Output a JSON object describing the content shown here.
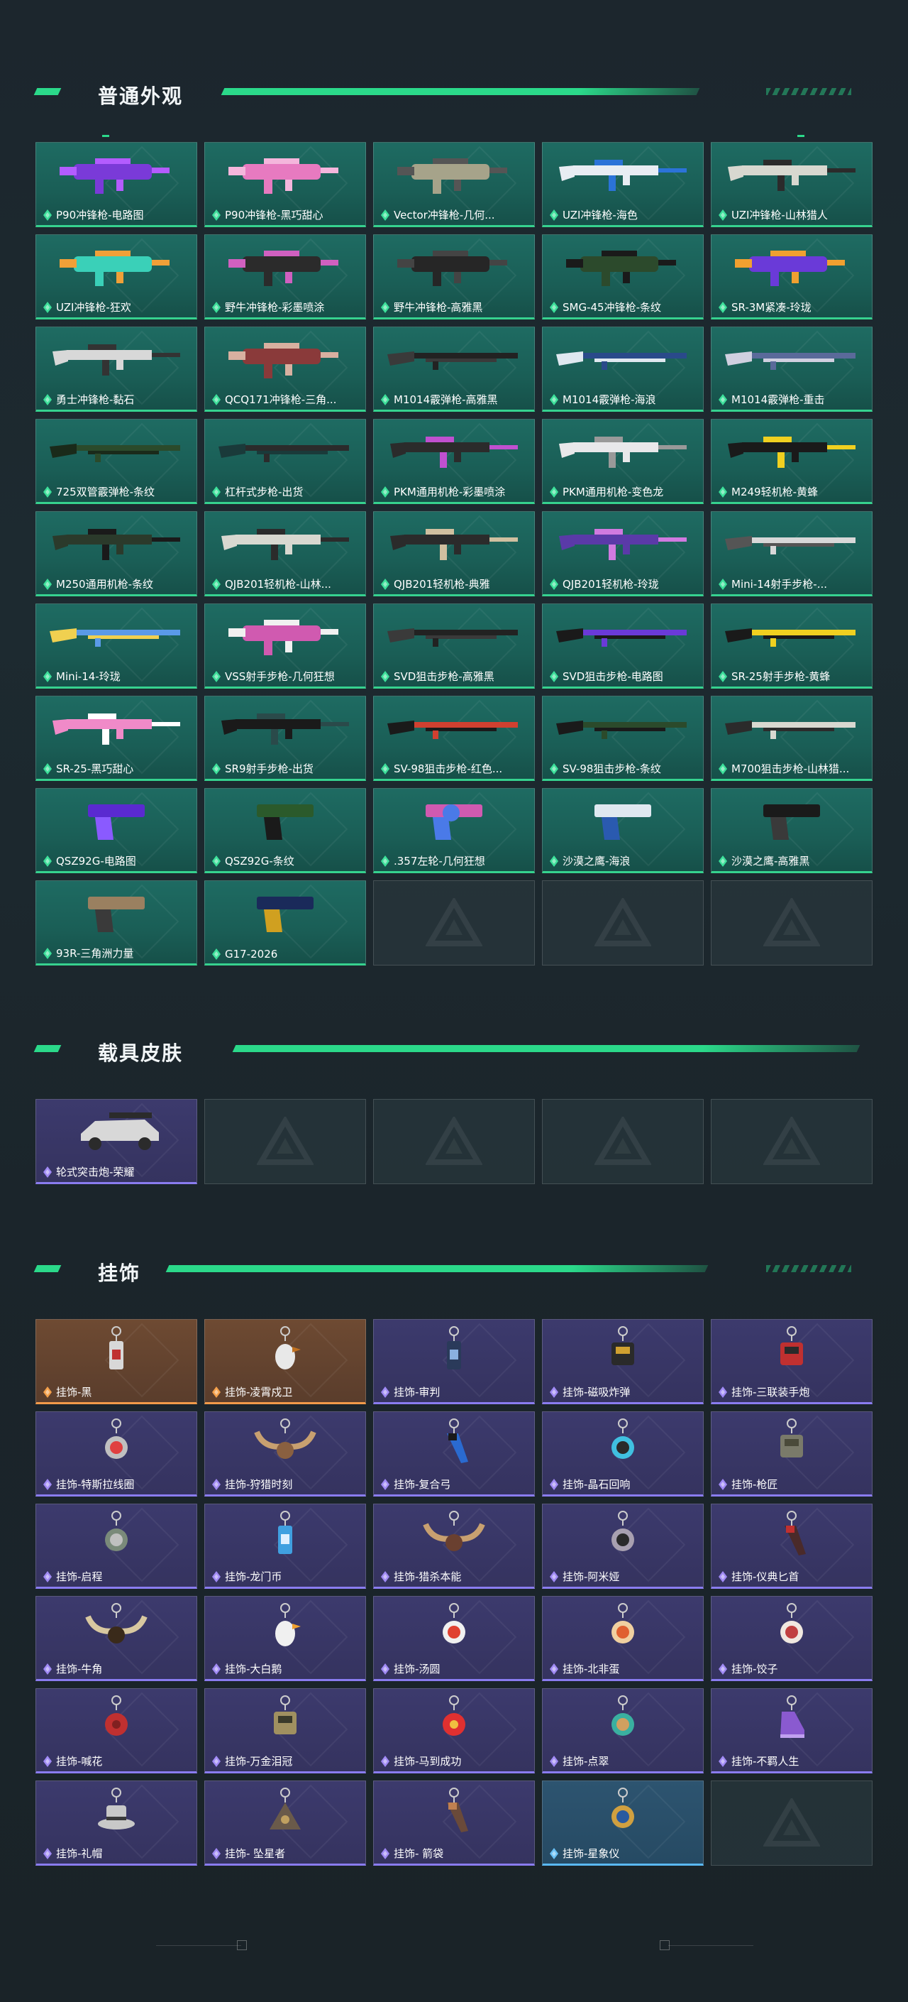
{
  "sections": {
    "weapons": {
      "title": "普通外观",
      "items": [
        {
          "label": "P90冲锋枪-电路图",
          "kind": "smg",
          "c1": "#7a3ad8",
          "c2": "#b35cff"
        },
        {
          "label": "P90冲锋枪-黑巧甜心",
          "kind": "smg",
          "c1": "#e77ac0",
          "c2": "#f4b6dc"
        },
        {
          "label": "Vector冲锋枪-几何...",
          "kind": "smg",
          "c1": "#a6a38a",
          "c2": "#555"
        },
        {
          "label": "UZI冲锋枪-海色",
          "kind": "rifle",
          "c1": "#e8edf3",
          "c2": "#2b73d8"
        },
        {
          "label": "UZI冲锋枪-山林猎人",
          "kind": "rifle",
          "c1": "#d8d8d0",
          "c2": "#2b2b2b"
        },
        {
          "label": "UZI冲锋枪-狂欢",
          "kind": "smg",
          "c1": "#3ad0b8",
          "c2": "#f0a038"
        },
        {
          "label": "野牛冲锋枪-彩墨喷涂",
          "kind": "smg",
          "c1": "#2b2b2b",
          "c2": "#d060c0"
        },
        {
          "label": "野牛冲锋枪-高雅黑",
          "kind": "smg",
          "c1": "#262626",
          "c2": "#444"
        },
        {
          "label": "SMG-45冲锋枪-条纹",
          "kind": "smg",
          "c1": "#2c4a2c",
          "c2": "#1a1a1a"
        },
        {
          "label": "SR-3M紧凑-玲珑",
          "kind": "smg",
          "c1": "#6a3ad8",
          "c2": "#f0a030"
        },
        {
          "label": "勇士冲锋枪-黏石",
          "kind": "rifle",
          "c1": "#d8d8d8",
          "c2": "#333"
        },
        {
          "label": "QCQ171冲锋枪-三角...",
          "kind": "smg",
          "c1": "#8a3a3a",
          "c2": "#d8b0a0"
        },
        {
          "label": "M1014霰弹枪-高雅黑",
          "kind": "shotgun",
          "c1": "#222",
          "c2": "#3a3a3a"
        },
        {
          "label": "M1014霰弹枪-海浪",
          "kind": "shotgun",
          "c1": "#2a4a8a",
          "c2": "#dfe8f0"
        },
        {
          "label": "M1014霰弹枪-重击",
          "kind": "shotgun",
          "c1": "#5a6a9a",
          "c2": "#d0d0e0"
        },
        {
          "label": "725双管霰弹枪-条纹",
          "kind": "shotgun",
          "c1": "#2b4a2b",
          "c2": "#1a2a1a"
        },
        {
          "label": "杠杆式步枪-出货",
          "kind": "shotgun",
          "c1": "#2b2b2b",
          "c2": "#1a3a3a"
        },
        {
          "label": "PKM通用机枪-彩墨喷涂",
          "kind": "rifle",
          "c1": "#2b2b2b",
          "c2": "#c050d0"
        },
        {
          "label": "PKM通用机枪-变色龙",
          "kind": "rifle",
          "c1": "#e8e8ea",
          "c2": "#999"
        },
        {
          "label": "M249轻机枪-黄蜂",
          "kind": "rifle",
          "c1": "#1a1a1a",
          "c2": "#f0d020"
        },
        {
          "label": "M250通用机枪-条纹",
          "kind": "rifle",
          "c1": "#2b3a2b",
          "c2": "#1a1a1a"
        },
        {
          "label": "QJB201轻机枪-山林...",
          "kind": "rifle",
          "c1": "#d8d8d0",
          "c2": "#2b2b2b"
        },
        {
          "label": "QJB201轻机枪-典雅",
          "kind": "rifle",
          "c1": "#2b2b2b",
          "c2": "#d0c0a0"
        },
        {
          "label": "QJB201轻机枪-玲珑",
          "kind": "rifle",
          "c1": "#5a3aa8",
          "c2": "#d07ae0"
        },
        {
          "label": "Mini-14射手步枪-...",
          "kind": "shotgun",
          "c1": "#d8d8d8",
          "c2": "#555"
        },
        {
          "label": "Mini-14-玲珑",
          "kind": "shotgun",
          "c1": "#5a9ae8",
          "c2": "#f0d050"
        },
        {
          "label": "VSS射手步枪-几何狂想",
          "kind": "smg",
          "c1": "#d05ab0",
          "c2": "#f0f0f0"
        },
        {
          "label": "SVD狙击步枪-高雅黑",
          "kind": "shotgun",
          "c1": "#222",
          "c2": "#3a3a3a"
        },
        {
          "label": "SVD狙击步枪-电路图",
          "kind": "shotgun",
          "c1": "#6a3ad8",
          "c2": "#1a1a1a"
        },
        {
          "label": "SR-25射手步枪-黄蜂",
          "kind": "shotgun",
          "c1": "#f0d020",
          "c2": "#1a1a1a"
        },
        {
          "label": "SR-25-黑巧甜心",
          "kind": "rifle",
          "c1": "#f08ac8",
          "c2": "#ffffff"
        },
        {
          "label": "SR9射手步枪-出货",
          "kind": "rifle",
          "c1": "#1a1a1a",
          "c2": "#2a4a4a"
        },
        {
          "label": "SV-98狙击步枪-红色...",
          "kind": "shotgun",
          "c1": "#d04030",
          "c2": "#1a1a1a"
        },
        {
          "label": "SV-98狙击步枪-条纹",
          "kind": "shotgun",
          "c1": "#2b4a2b",
          "c2": "#1a1a1a"
        },
        {
          "label": "M700狙击步枪-山林猎...",
          "kind": "shotgun",
          "c1": "#d8d8d0",
          "c2": "#2b2b2b"
        },
        {
          "label": "QSZ92G-电路图",
          "kind": "pistol",
          "c1": "#5a2ad0",
          "c2": "#8a5aff"
        },
        {
          "label": "QSZ92G-条纹",
          "kind": "pistol",
          "c1": "#2b5a2b",
          "c2": "#1a1a1a"
        },
        {
          "label": ".357左轮-几何狂想",
          "kind": "revolver",
          "c1": "#d05ab0",
          "c2": "#4a7ae8"
        },
        {
          "label": "沙漠之鹰-海浪",
          "kind": "pistol",
          "c1": "#dfe8f0",
          "c2": "#2a5ab0"
        },
        {
          "label": "沙漠之鹰-高雅黑",
          "kind": "pistol",
          "c1": "#1a1a1a",
          "c2": "#3a3a3a"
        },
        {
          "label": "93R-三角洲力量",
          "kind": "pistol",
          "c1": "#9a8060",
          "c2": "#3a3a3a"
        },
        {
          "label": "G17-2026",
          "kind": "pistol",
          "c1": "#1a2a5a",
          "c2": "#d0a020"
        },
        {
          "empty": true
        },
        {
          "empty": true
        },
        {
          "empty": true
        }
      ]
    },
    "vehicles": {
      "title": "载具皮肤",
      "items": [
        {
          "label": "轮式突击炮-荣耀",
          "kind": "vehicle",
          "c1": "#d8d8d8",
          "c2": "#2b2b2b"
        },
        {
          "empty": true
        },
        {
          "empty": true
        },
        {
          "empty": true
        },
        {
          "empty": true
        }
      ]
    },
    "charms": {
      "title": "挂饰",
      "items": [
        {
          "label": "挂饰-黑",
          "rarity": "orange",
          "kind": "tag",
          "c1": "#d8d8d8",
          "c2": "#c03030"
        },
        {
          "label": "挂饰-凌霄戍卫",
          "rarity": "orange",
          "kind": "bird",
          "c1": "#e8e8e8",
          "c2": "#c07020"
        },
        {
          "label": "挂饰-审判",
          "rarity": "purple",
          "kind": "tag",
          "c1": "#2a3a5a",
          "c2": "#8ab0e0"
        },
        {
          "label": "挂饰-磁吸炸弹",
          "rarity": "purple",
          "kind": "box",
          "c1": "#2a2a2a",
          "c2": "#d0a030"
        },
        {
          "label": "挂饰-三联装手炮",
          "rarity": "purple",
          "kind": "box",
          "c1": "#c03030",
          "c2": "#2a2a2a"
        },
        {
          "label": "挂饰-特斯拉线圈",
          "rarity": "purple",
          "kind": "ring",
          "c1": "#c0c0c0",
          "c2": "#e04040"
        },
        {
          "label": "挂饰-狩猎时刻",
          "rarity": "purple",
          "kind": "antler",
          "c1": "#c8a070",
          "c2": "#8a6040"
        },
        {
          "label": "挂饰-复合弓",
          "rarity": "purple",
          "kind": "bow",
          "c1": "#2a6ad0",
          "c2": "#1a1a1a"
        },
        {
          "label": "挂饰-晶石回响",
          "rarity": "purple",
          "kind": "ring",
          "c1": "#40c0e0",
          "c2": "#2a2a2a"
        },
        {
          "label": "挂饰-枪匠",
          "rarity": "purple",
          "kind": "box",
          "c1": "#7a7a6a",
          "c2": "#4a4a3a"
        },
        {
          "label": "挂饰-启程",
          "rarity": "purple",
          "kind": "round",
          "c1": "#7a8a7a",
          "c2": "#c0c0c0"
        },
        {
          "label": "挂饰-龙门币",
          "rarity": "purple",
          "kind": "tag",
          "c1": "#40a0e0",
          "c2": "#e0f0ff"
        },
        {
          "label": "挂饰-猎杀本能",
          "rarity": "purple",
          "kind": "antler",
          "c1": "#c8a070",
          "c2": "#6a4030"
        },
        {
          "label": "挂饰-阿米娅",
          "rarity": "purple",
          "kind": "round",
          "c1": "#a8a0b0",
          "c2": "#2a2a2a"
        },
        {
          "label": "挂饰-仪典匕首",
          "rarity": "purple",
          "kind": "knife",
          "c1": "#4a2a2a",
          "c2": "#c03030"
        },
        {
          "label": "挂饰-牛角",
          "rarity": "purple",
          "kind": "horn",
          "c1": "#d8c8a0",
          "c2": "#3a2a1a"
        },
        {
          "label": "挂饰-大白鹅",
          "rarity": "purple",
          "kind": "bird",
          "c1": "#f0f0f0",
          "c2": "#f0a030"
        },
        {
          "label": "挂饰-汤圆",
          "rarity": "purple",
          "kind": "round",
          "c1": "#f0f0f0",
          "c2": "#e04030"
        },
        {
          "label": "挂饰-北非蛋",
          "rarity": "purple",
          "kind": "round",
          "c1": "#f0d0a0",
          "c2": "#e06030"
        },
        {
          "label": "挂饰-饺子",
          "rarity": "purple",
          "kind": "round",
          "c1": "#f0e8e0",
          "c2": "#c04040"
        },
        {
          "label": "挂饰-喊花",
          "rarity": "purple",
          "kind": "flower",
          "c1": "#c03030",
          "c2": "#802020"
        },
        {
          "label": "挂饰-万金泪冠",
          "rarity": "purple",
          "kind": "box",
          "c1": "#a09060",
          "c2": "#3a3a2a"
        },
        {
          "label": "挂饰-马到成功",
          "rarity": "purple",
          "kind": "flower",
          "c1": "#e03030",
          "c2": "#f0c040"
        },
        {
          "label": "挂饰-点翠",
          "rarity": "purple",
          "kind": "round",
          "c1": "#3ab0a0",
          "c2": "#d0a060"
        },
        {
          "label": "挂饰-不羁人生",
          "rarity": "purple",
          "kind": "shoe",
          "c1": "#8a5ad0",
          "c2": "#c0a0f0"
        },
        {
          "label": "挂饰-礼帽",
          "rarity": "purple",
          "kind": "hat",
          "c1": "#c8c8c8",
          "c2": "#3a3a3a"
        },
        {
          "label": "挂饰- 坠星者",
          "rarity": "purple",
          "kind": "tri",
          "c1": "#6a5a4a",
          "c2": "#c0a060"
        },
        {
          "label": "挂饰- 箭袋",
          "rarity": "purple",
          "kind": "knife",
          "c1": "#6a4a3a",
          "c2": "#c08050"
        },
        {
          "label": "挂饰-星象仪",
          "rarity": "blue",
          "kind": "round",
          "c1": "#d0a040",
          "c2": "#2a5aa0"
        },
        {
          "empty": true
        }
      ]
    }
  },
  "colors": {
    "accent": "#2bd98a",
    "green_card": "#1e6b62",
    "purple_card": "#3c3a6d",
    "orange_card": "#6e4a32",
    "blue_card": "#2d5470"
  }
}
